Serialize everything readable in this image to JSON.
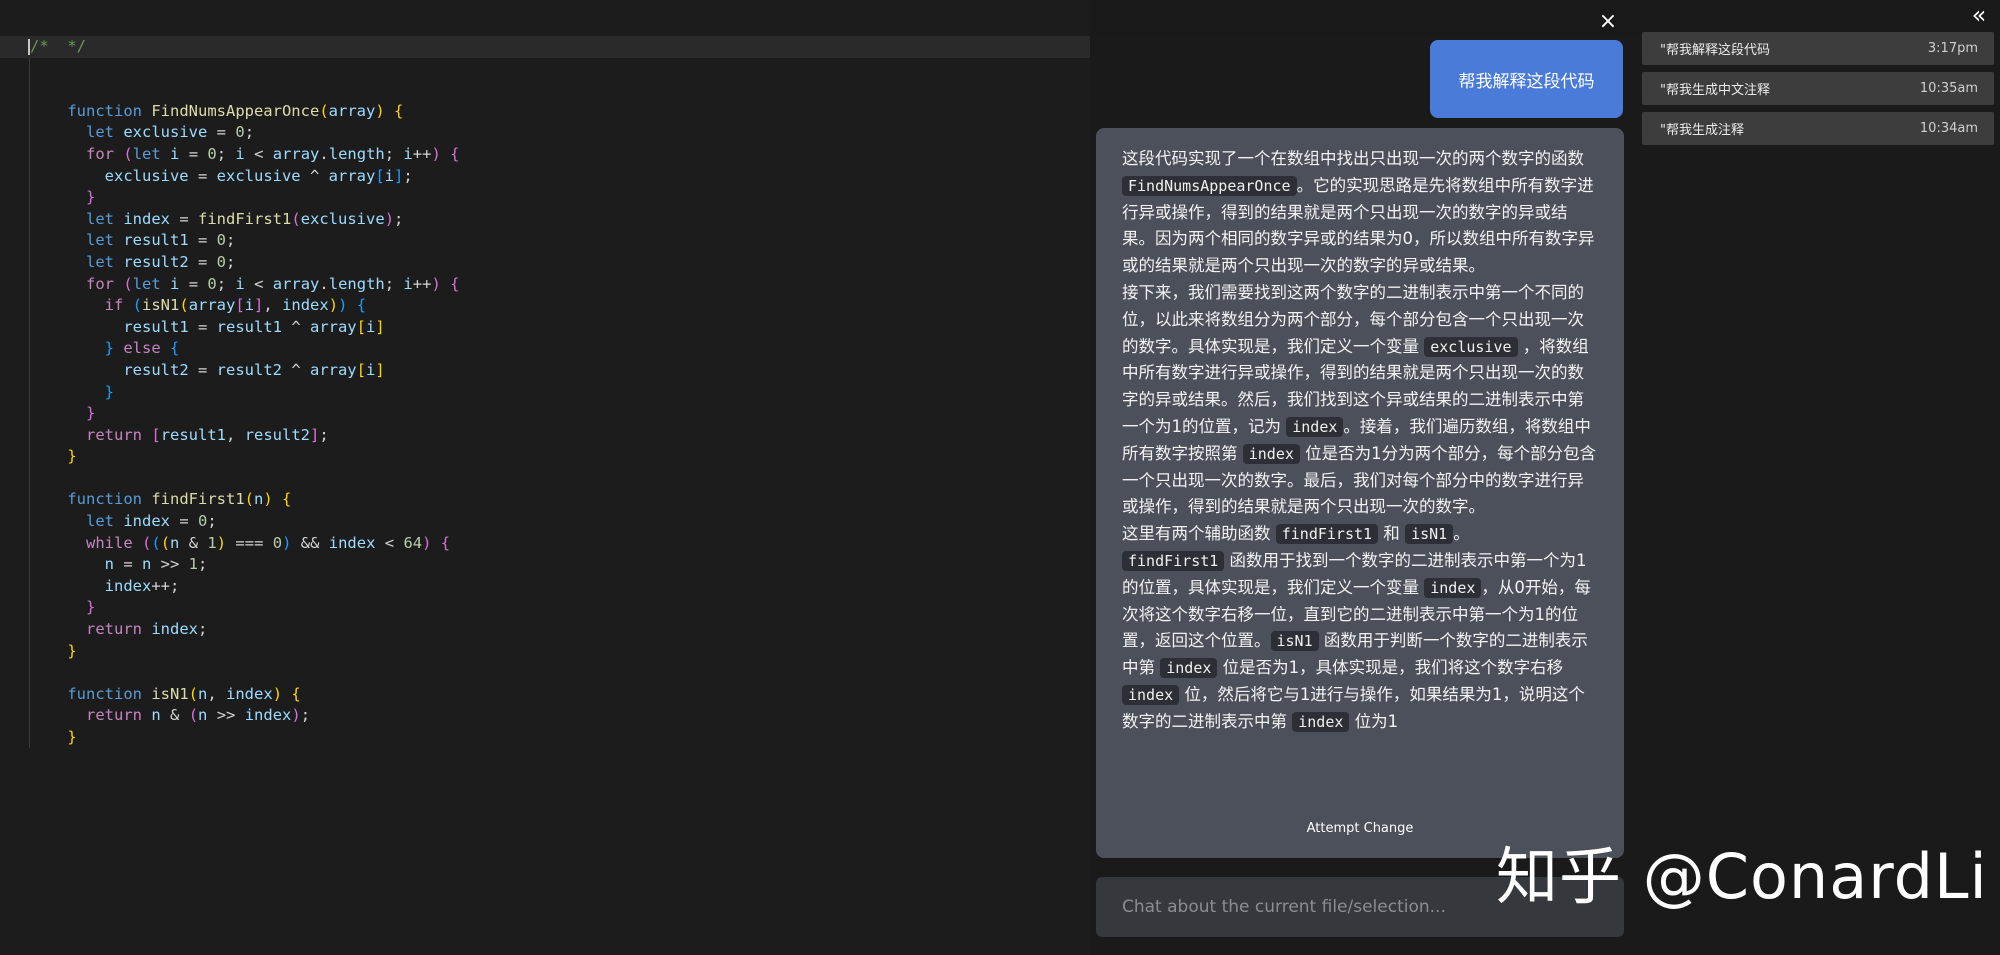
{
  "editor": {
    "comment_line": "/*  */"
  },
  "chat": {
    "close_icon": "×",
    "user_message": "帮我解释这段代码",
    "answer_paragraphs": [
      [
        {
          "t": "这段代码实现了一个在数组中找出只出现一次的两个数字的函数 "
        },
        {
          "c": "FindNumsAppearOnce"
        },
        {
          "t": "。它的实现思路是先将数组中所有数字进行异或操作，得到的结果就是两个只出现一次的数字的异或结果。因为两个相同的数字异或的结果为0，所以数组中所有数字异或的结果就是两个只出现一次的数字的异或结果。"
        }
      ],
      [
        {
          "t": "接下来，我们需要找到这两个数字的二进制表示中第一个不同的位，以此来将数组分为两个部分，每个部分包含一个只出现一次的数字。具体实现是，我们定义一个变量 "
        },
        {
          "c": "exclusive"
        },
        {
          "t": " ，将数组中所有数字进行异或操作，得到的结果就是两个只出现一次的数字的异或结果。然后，我们找到这个异或结果的二进制表示中第一个为1的位置，记为 "
        },
        {
          "c": "index"
        },
        {
          "t": "。接着，我们遍历数组，将数组中所有数字按照第 "
        },
        {
          "c": "index"
        },
        {
          "t": " 位是否为1分为两个部分，每个部分包含一个只出现一次的数字。最后，我们对每个部分中的数字进行异或操作，得到的结果就是两个只出现一次的数字。"
        }
      ],
      [
        {
          "t": "这里有两个辅助函数 "
        },
        {
          "c": "findFirst1"
        },
        {
          "t": " 和 "
        },
        {
          "c": "isN1"
        },
        {
          "t": "。"
        }
      ],
      [
        {
          "c": "findFirst1"
        },
        {
          "t": " 函数用于找到一个数字的二进制表示中第一个为1的位置，具体实现是，我们定义一个变量 "
        },
        {
          "c": "index"
        },
        {
          "t": "，从0开始，每次将这个数字右移一位，直到它的二进制表示中第一个为1的位置，返回这个位置。"
        },
        {
          "c": "isN1"
        },
        {
          "t": " 函数用于判断一个数字的二进制表示中第 "
        },
        {
          "c": "index"
        },
        {
          "t": " 位是否为1，具体实现是，我们将这个数字右移 "
        },
        {
          "c": "index"
        },
        {
          "t": " 位，然后将它与1进行与操作，如果结果为1，说明这个数字的二进制表示中第 "
        },
        {
          "c": "index"
        },
        {
          "t": " 位为1"
        }
      ]
    ],
    "attempt_change_label": "Attempt Change",
    "input_placeholder": "Chat about the current file/selection..."
  },
  "history": {
    "collapse_icon": "«",
    "items": [
      {
        "label": "\"帮我解释这段代码",
        "time": "3:17pm"
      },
      {
        "label": "\"帮我生成中文注释",
        "time": "10:35am"
      },
      {
        "label": "\"帮我生成注释",
        "time": "10:34am"
      }
    ]
  },
  "watermark": "知乎 @ConardLi",
  "colors": {
    "user_bubble": "#4a7bd8",
    "assistant_bubble": "#4b505a",
    "history_item": "#3d3d3d",
    "editor_bg": "#1c1c1c"
  }
}
